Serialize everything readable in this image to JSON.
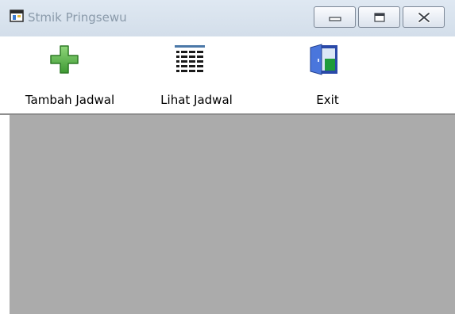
{
  "window": {
    "title": "Stmik Pringsewu",
    "controls": {
      "minimize_icon": "minimize-icon",
      "maximize_icon": "maximize-icon",
      "close_icon": "close-icon"
    }
  },
  "toolbar": {
    "items": [
      {
        "label": "Tambah Jadwal",
        "icon": "plus-icon"
      },
      {
        "label": "Lihat Jadwal",
        "icon": "table-list-icon"
      },
      {
        "label": "Exit",
        "icon": "exit-door-icon"
      }
    ]
  },
  "colors": {
    "titlebar": "#d8e2ee",
    "client_area": "#ababab",
    "plus_green": "#5fb84a",
    "door_blue": "#3d6bd6",
    "door_green": "#1e9b3a"
  }
}
